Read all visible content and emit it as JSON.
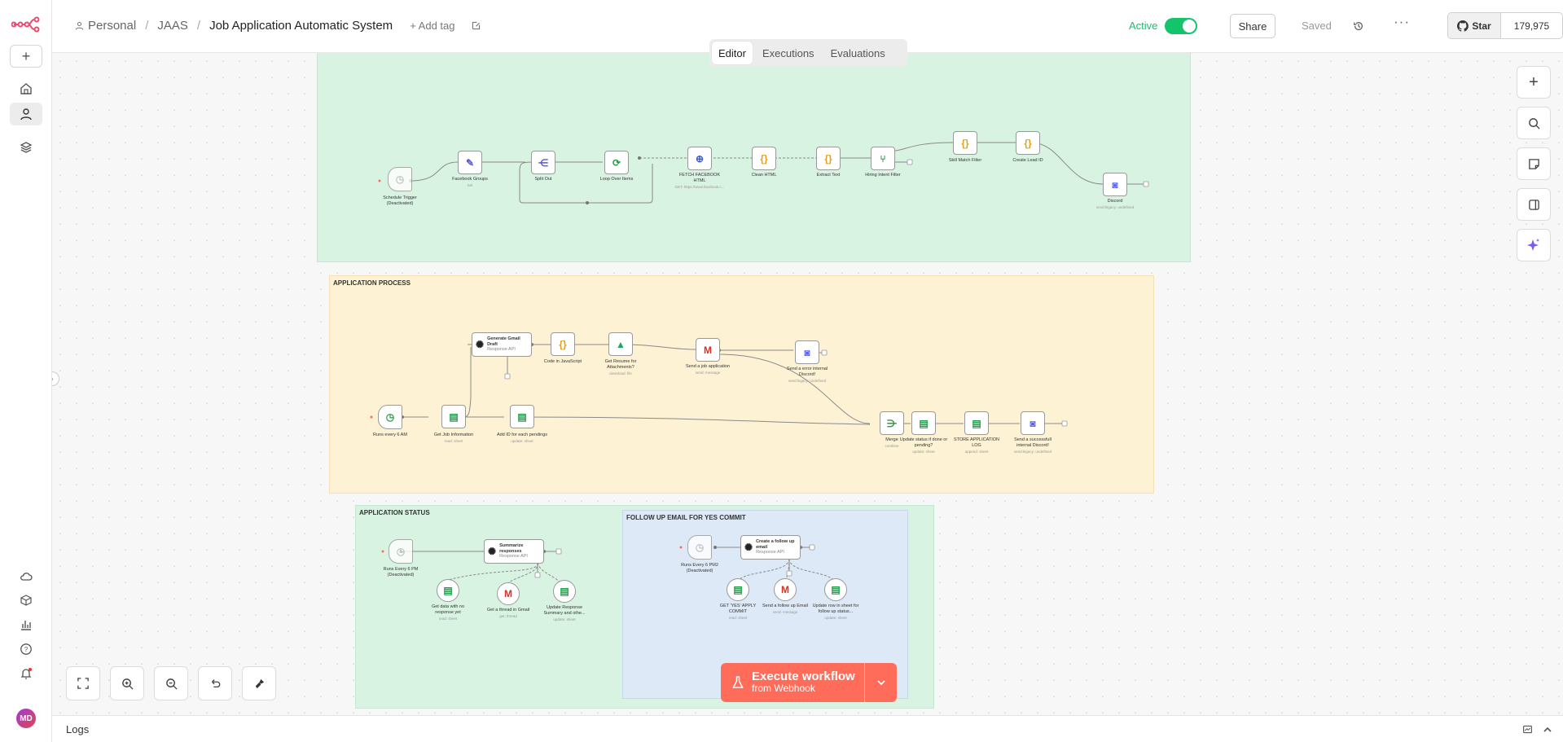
{
  "header": {
    "breadcrumb": {
      "project": "Personal",
      "folder": "JAAS",
      "workflow": "Job Application Automatic System"
    },
    "add_tag": "+ Add tag",
    "status_label": "Active",
    "share": "Share",
    "saved": "Saved",
    "github": {
      "star": "Star",
      "count": "179,975"
    }
  },
  "tabs": [
    "Editor",
    "Executions",
    "Evaluations"
  ],
  "sidebar": {
    "avatar": "MD"
  },
  "canvas": {
    "groups": {
      "application_process": "APPLICATION PROCESS",
      "application_status": "APPLICATION STATUS",
      "follow_up": "FOLLOW UP EMAIL FOR YES COMMIT"
    },
    "nodes": {
      "schedule_trigger": {
        "title": "Schedule Trigger (Deactivated)"
      },
      "facebook_groups": {
        "title": "Facebook Groups",
        "sub": "Set"
      },
      "split_out": {
        "title": "Split Out"
      },
      "loop_over_items": {
        "title": "Loop Over Items"
      },
      "fetch_html": {
        "title": "FETCH FACEBOOK HTML",
        "sub": "GET: https://www.facebook.c..."
      },
      "clean_html": {
        "title": "Clean HTML"
      },
      "extract_text": {
        "title": "Extract Text"
      },
      "hiring_intent_filter": {
        "title": "Hiring Intent Filter"
      },
      "skill_match_filter": {
        "title": "Skill Match Filter"
      },
      "create_lead_id": {
        "title": "Create Lead ID"
      },
      "discord_1": {
        "title": "Discord",
        "sub": "send:legacy: undefined"
      },
      "generate_gmail_draft": {
        "title": "Generate Gmail Draft",
        "sub": "Response API"
      },
      "code_js": {
        "title": "Code in JavaScript"
      },
      "get_resume": {
        "title": "Get Resume for Attachments?",
        "sub": "download: file"
      },
      "send_job_application": {
        "title": "Send a job application",
        "sub": "send: message"
      },
      "send_error_discord": {
        "title": "Send a error internal Discord!",
        "sub": "send:legacy: undefined"
      },
      "runs_6am": {
        "title": "Runs every 6 AM"
      },
      "get_job_info": {
        "title": "Get Job Information",
        "sub": "read: sheet"
      },
      "add_id": {
        "title": "Add ID for each pendings",
        "sub": "update: sheet"
      },
      "merge": {
        "title": "Merge",
        "sub": "combine"
      },
      "update_status": {
        "title": "Update status if done or pending?",
        "sub": "update: sheet"
      },
      "store_log": {
        "title": "STORE APPLICATION LOG",
        "sub": "append: sheet"
      },
      "send_success_discord": {
        "title": "Send a successfull internal Discord!",
        "sub": "send:legacy: undefined"
      },
      "runs_6pm": {
        "title": "Runs Every 6 PM (Deactivated)"
      },
      "summarize_responses": {
        "title": "Summarize responses",
        "sub": "Response API"
      },
      "get_no_response": {
        "title": "Get data with no response yet",
        "sub": "read: sheet"
      },
      "get_thread": {
        "title": "Get a thread in Gmail",
        "sub": "get: thread"
      },
      "update_response": {
        "title": "Update Response Summary and othe...",
        "sub": "update: sheet"
      },
      "runs_6pm_2": {
        "title": "Runs Every 6 PM2 (Deactivated)"
      },
      "create_follow_up": {
        "title": "Create a follow up email",
        "sub": "Response API"
      },
      "get_yes_apply": {
        "title": "GET 'YES' APPLY COMMIT",
        "sub": "read: sheet"
      },
      "send_follow_up": {
        "title": "Send a follow up Email",
        "sub": "send: message"
      },
      "update_follow_up": {
        "title": "Update row in sheet for follow up status...",
        "sub": "update: sheet"
      }
    }
  },
  "execute": {
    "label": "Execute workflow",
    "sub": "from Webhook"
  },
  "logs": {
    "label": "Logs"
  },
  "colors": {
    "accent": "#ff6d5a",
    "active": "#13c46a"
  }
}
